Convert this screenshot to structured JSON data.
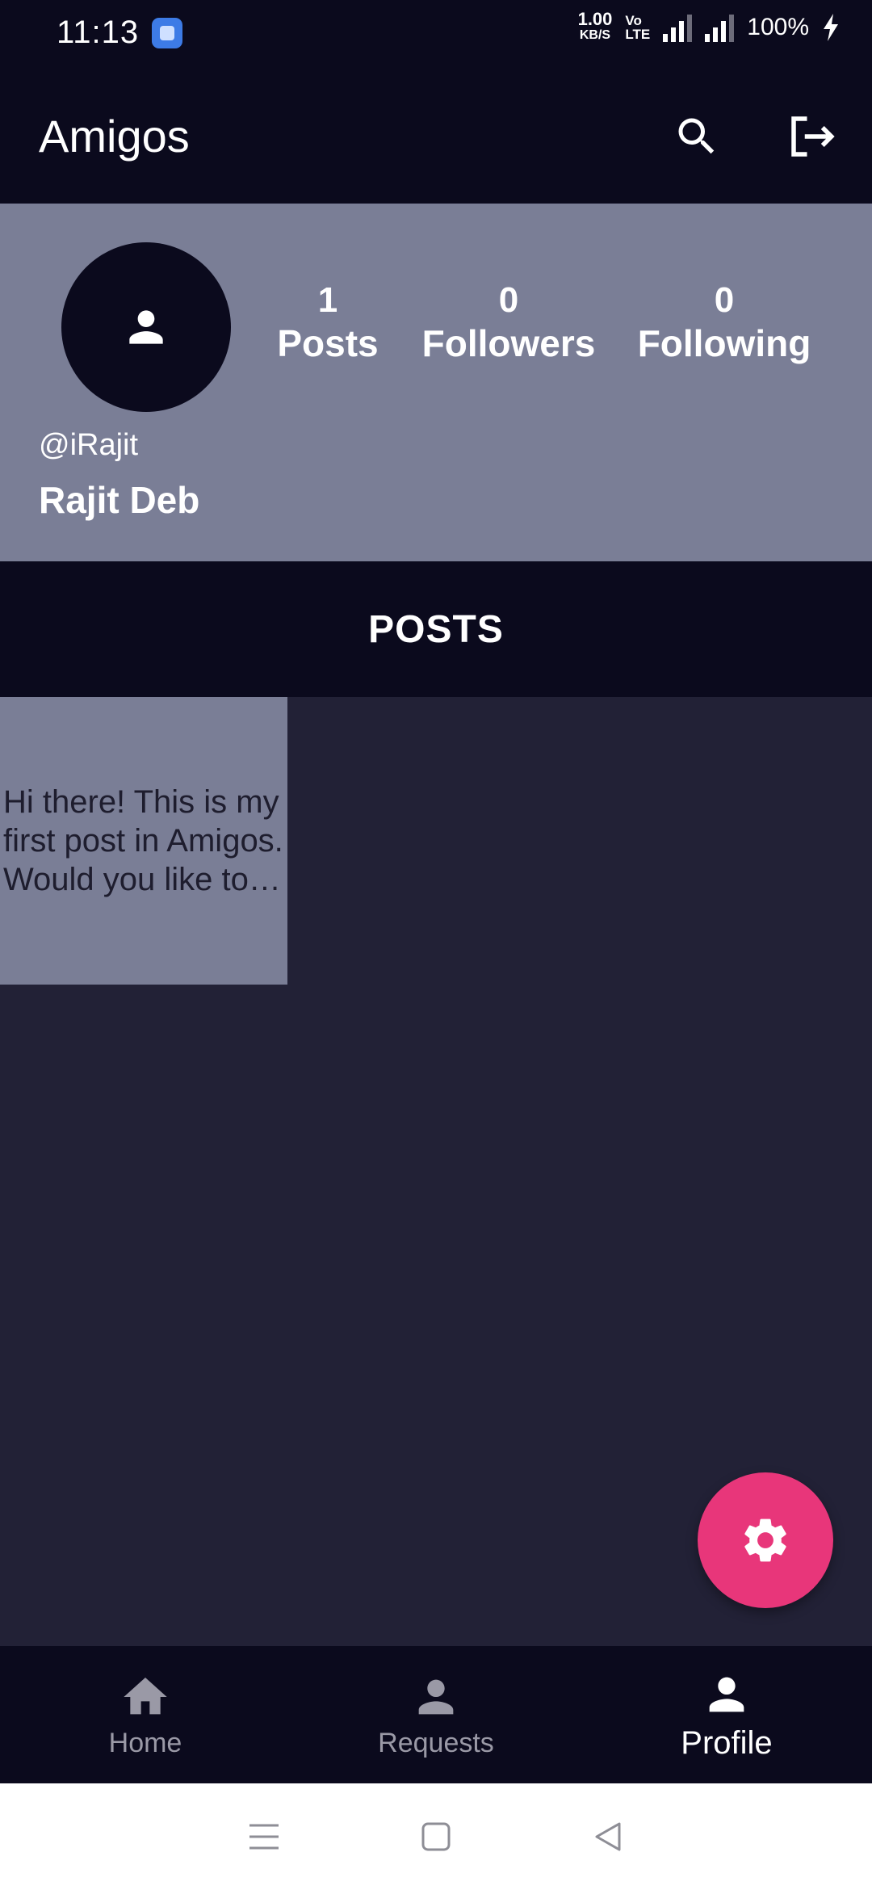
{
  "status_bar": {
    "time": "11:13",
    "net_speed": "1.00",
    "net_unit": "KB/S",
    "volte": "VoLTE2",
    "battery": "100%"
  },
  "app_bar": {
    "title": "Amigos",
    "actions": [
      "search-icon",
      "logout-icon"
    ]
  },
  "profile": {
    "handle": "@iRajit",
    "name": "Rajit Deb",
    "stats": [
      {
        "value": "1",
        "label": "Posts"
      },
      {
        "value": "0",
        "label": "Followers"
      },
      {
        "value": "0",
        "label": "Following"
      }
    ]
  },
  "posts_section": {
    "title": "POSTS",
    "posts": [
      {
        "text": "Hi there! This is my first post in Amigos. Would you like to be my friend?"
      }
    ]
  },
  "fab": {
    "icon": "settings-icon",
    "color": "#e8367a"
  },
  "bottom_nav": {
    "items": [
      {
        "label": "Home",
        "icon": "home-icon"
      },
      {
        "label": "Requests",
        "icon": "person-icon"
      },
      {
        "label": "Profile",
        "icon": "person-icon"
      }
    ],
    "active": "Profile"
  },
  "colors": {
    "primary_dark": "#0b0a1d",
    "surface": "#222136",
    "header_gray": "#7a7e96",
    "accent": "#e8367a"
  }
}
